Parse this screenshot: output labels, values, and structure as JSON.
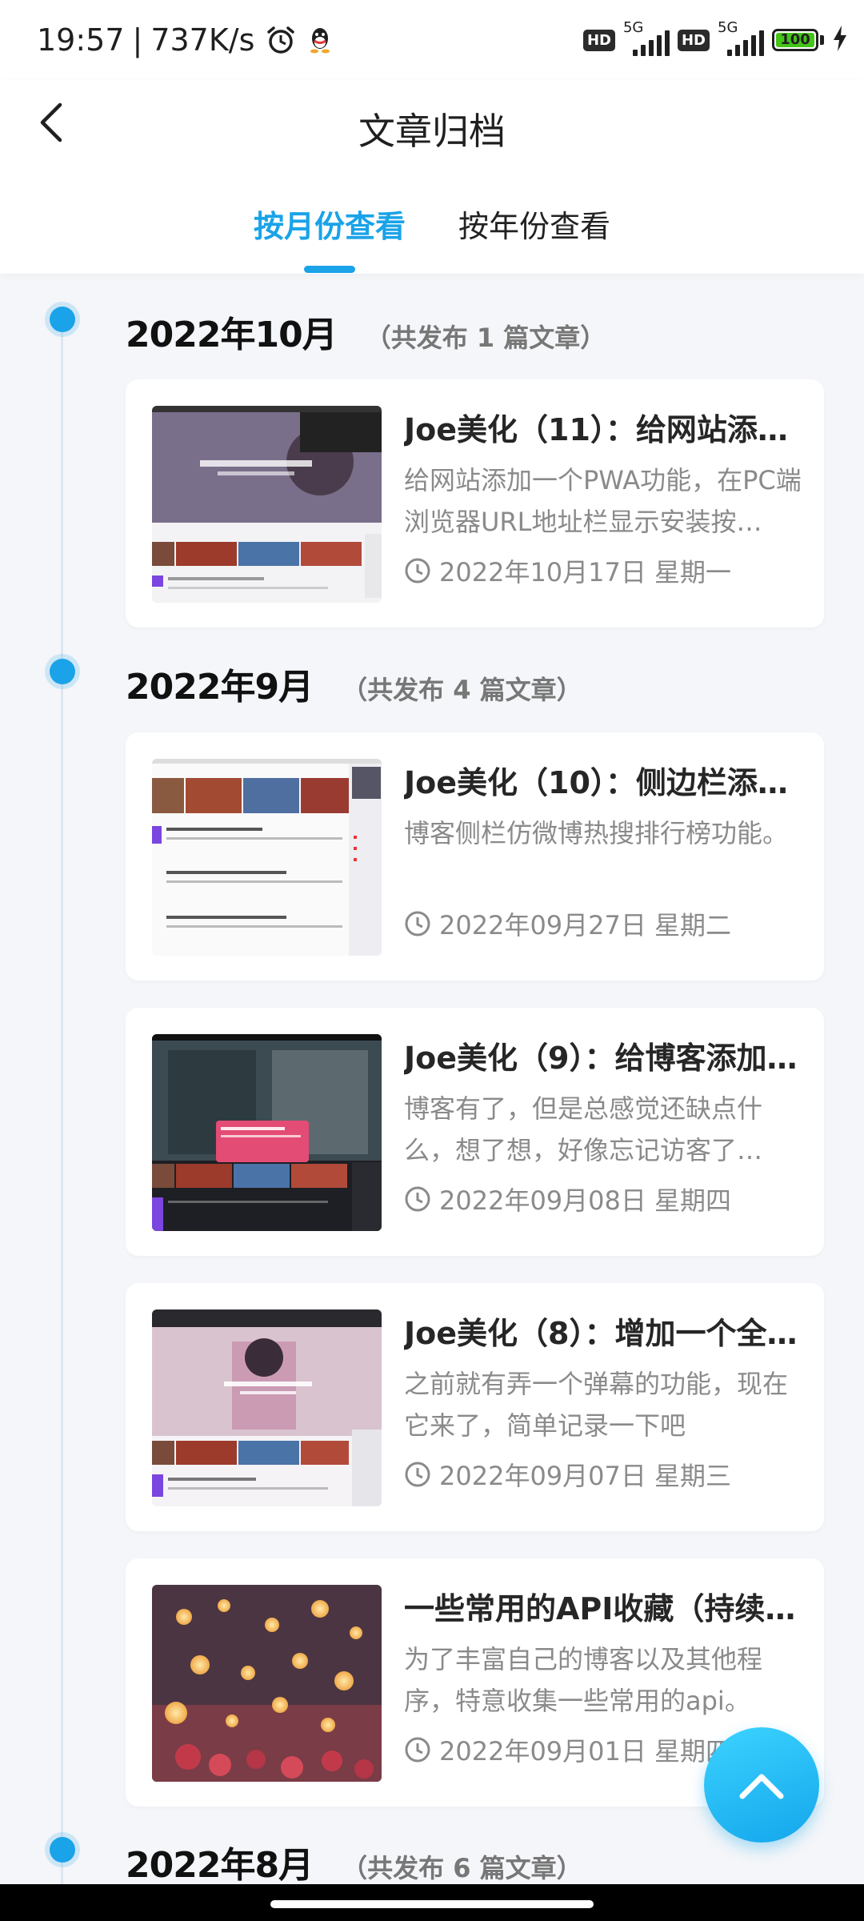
{
  "status_bar": {
    "time": "19:57",
    "net_speed": "737K/s",
    "hd1": "HD",
    "net1": "5G",
    "hd2": "HD",
    "net2": "5G",
    "battery": "100",
    "battery_level": 1.0
  },
  "header": {
    "title": "文章归档",
    "tabs": [
      {
        "label": "按月份查看",
        "active": true
      },
      {
        "label": "按年份查看",
        "active": false
      }
    ]
  },
  "months": [
    {
      "title": "2022年10月",
      "count": "（共发布 1 篇文章）",
      "articles": [
        {
          "title": "Joe美化（11）：给网站添…",
          "excerpt": "给网站添加一个PWA功能，在PC端浏览器URL地址栏显示安装按…",
          "date": "2022年10月17日 星期一"
        }
      ]
    },
    {
      "title": "2022年9月",
      "count": "（共发布 4 篇文章）",
      "articles": [
        {
          "title": "Joe美化（10）：侧边栏添…",
          "excerpt": "博客侧栏仿微博热搜排行榜功能。",
          "date": "2022年09月27日 星期二"
        },
        {
          "title": "Joe美化（9）：给博客添加…",
          "excerpt": "博客有了，但是总感觉还缺点什么，想了想，好像忘记访客了…",
          "date": "2022年09月08日 星期四"
        },
        {
          "title": "Joe美化（8）：增加一个全…",
          "excerpt": "之前就有弄一个弹幕的功能，现在它来了，简单记录一下吧",
          "date": "2022年09月07日 星期三"
        },
        {
          "title": "一些常用的API收藏（持续…",
          "excerpt": "为了丰富自己的博客以及其他程序，特意收集一些常用的api。",
          "date": "2022年09月01日 星期四"
        }
      ]
    },
    {
      "title": "2022年8月",
      "count": "（共发布 6 篇文章）",
      "articles": []
    }
  ],
  "icons": {
    "back": "back-arrow-icon",
    "clock": "clock-icon",
    "scroll_top": "chevron-up-icon",
    "alarm": "alarm-icon",
    "qq": "qq-icon",
    "charging": "lightning-icon"
  },
  "colors": {
    "accent": "#1aa3e8",
    "background": "#f4f6f9",
    "battery_green": "#45c41a"
  }
}
